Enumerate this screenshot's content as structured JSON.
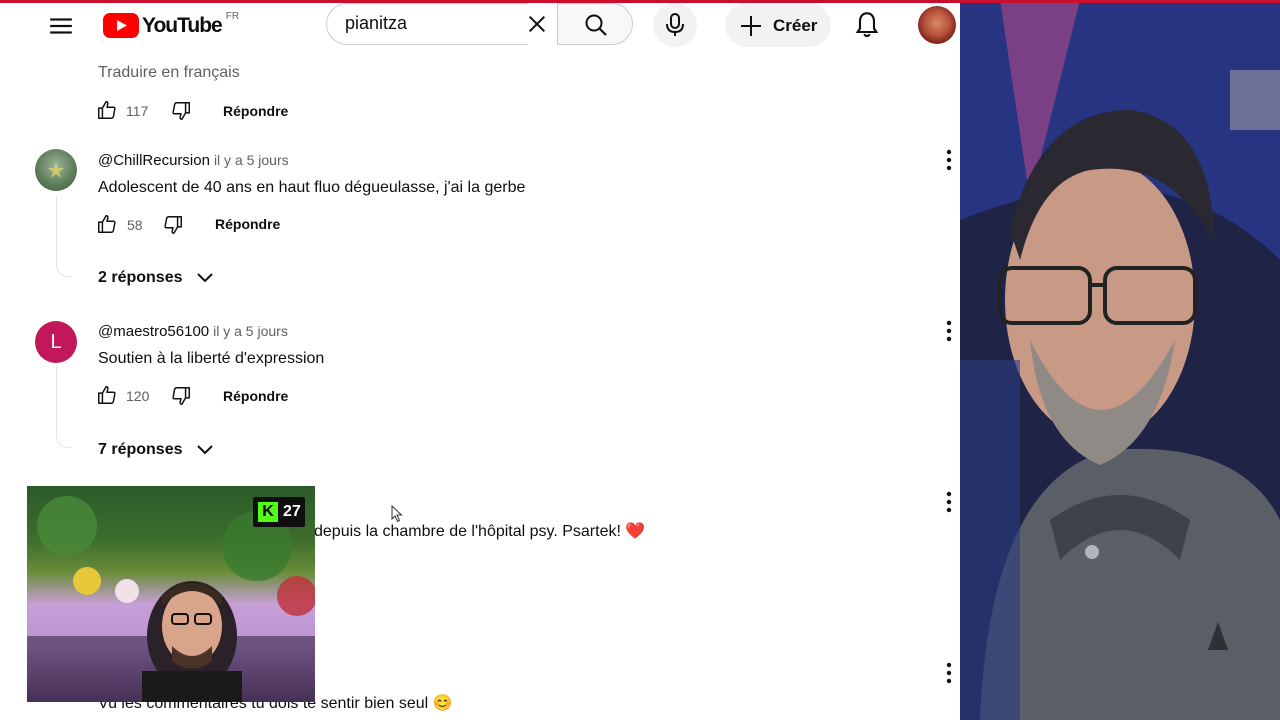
{
  "header": {
    "logo_text": "YouTube",
    "country_code": "FR",
    "search_value": "pianitza",
    "create_label": "Créer"
  },
  "comments": [
    {
      "translate_label": "Traduire en français",
      "likes": "117",
      "reply_label": "Répondre"
    },
    {
      "author": "@ChillRecursion",
      "time": "il y a 5 jours",
      "text": "Adolescent de 40 ans en haut fluo dégueulasse, j'ai la gerbe",
      "likes": "58",
      "reply_label": "Répondre",
      "replies_label": "2 réponses",
      "avatar_color": "#5a7a5a"
    },
    {
      "author": "@maestro56100",
      "time": "il y a 5 jours",
      "avatar_letter": "L",
      "avatar_color": "#c2185b",
      "text": "Soutien à la liberté d'expression",
      "likes": "120",
      "reply_label": "Répondre",
      "replies_label": "7 réponses"
    },
    {
      "text": "depuis la chambre de l'hôpital psy. Psartek! ❤️"
    },
    {
      "text": "Vu les commentaires tu dois te sentir bien seul 😊"
    }
  ],
  "overlay": {
    "kick_letter": "K",
    "kick_viewers": "27"
  }
}
